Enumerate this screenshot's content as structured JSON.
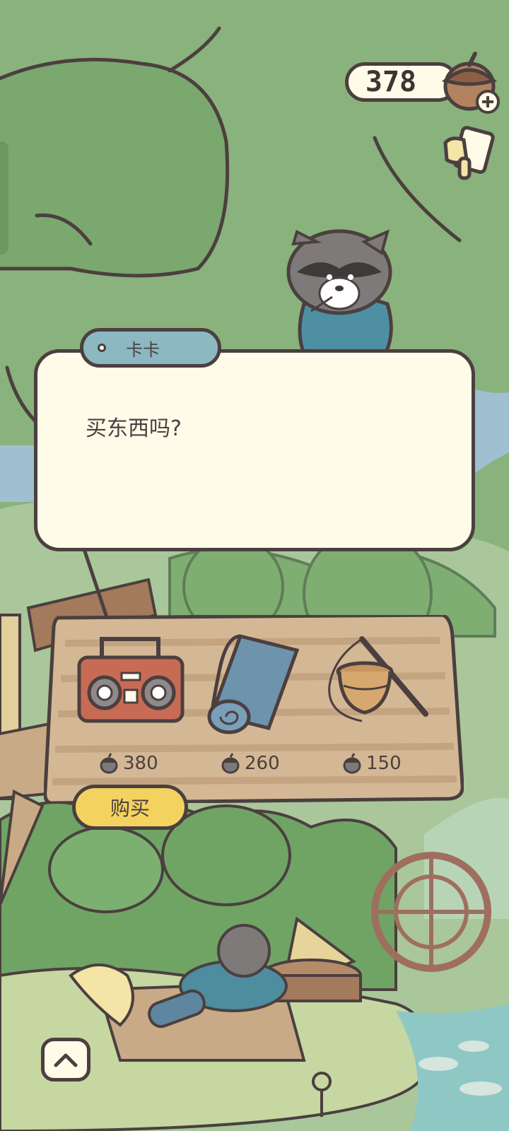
{
  "currency": {
    "value": "378",
    "icon": "acorn-add-icon"
  },
  "tool": {
    "icon": "hammer-icon"
  },
  "dialog": {
    "speaker": "卡卡",
    "text": "买东西吗?"
  },
  "shop": {
    "items": [
      {
        "icon": "boombox-icon",
        "price": "380"
      },
      {
        "icon": "rolled-mat-icon",
        "price": "260"
      },
      {
        "icon": "fishing-basket-icon",
        "price": "150"
      }
    ],
    "buy_label": "购买"
  },
  "nav": {
    "expand_icon": "chevron-up-icon"
  },
  "colors": {
    "outline": "#4b3f3f",
    "panel": "#fffbe9",
    "tab": "#8cb8c2",
    "button": "#f3d25f",
    "foliage": "#88b47a",
    "board": "#c9aa86"
  }
}
